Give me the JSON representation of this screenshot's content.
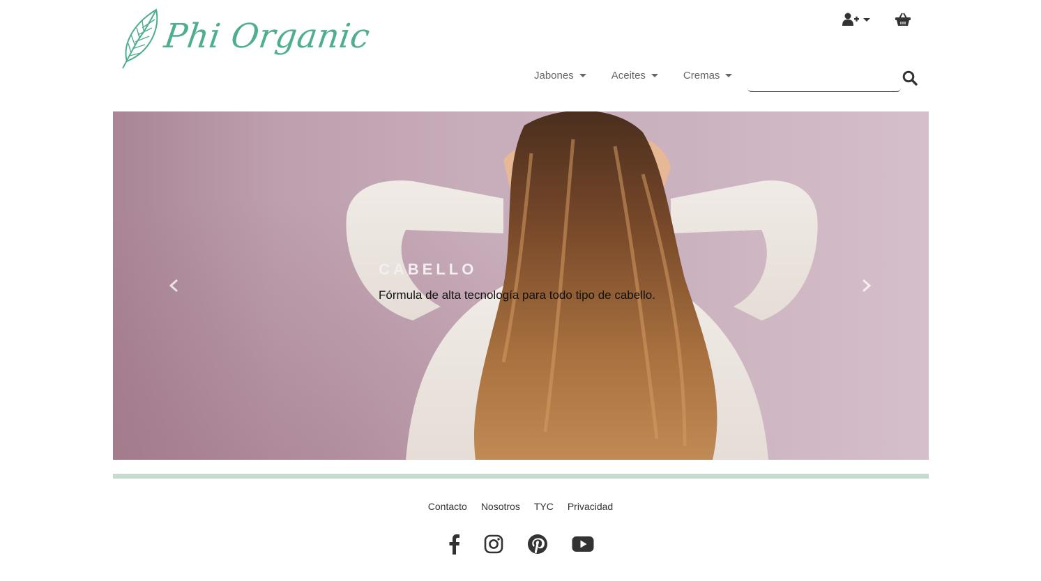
{
  "brand": {
    "name": "Phi Organic",
    "color": "#4fae8e"
  },
  "header": {
    "account_icon": "user-plus-icon",
    "cart_icon": "shopping-basket-icon"
  },
  "nav": {
    "items": [
      {
        "label": "Jabones"
      },
      {
        "label": "Aceites"
      },
      {
        "label": "Cremas"
      }
    ]
  },
  "search": {
    "value": "",
    "placeholder": "",
    "icon": "search-icon"
  },
  "carousel": {
    "slide": {
      "title": "CABELLO",
      "caption": "Fórmula de alta tecnología para todo tipo de cabello."
    },
    "prev_icon": "chevron-left-icon",
    "next_icon": "chevron-right-icon"
  },
  "footer": {
    "links": [
      {
        "label": "Contacto"
      },
      {
        "label": "Nosotros"
      },
      {
        "label": "TYC"
      },
      {
        "label": "Privacidad"
      }
    ],
    "social": [
      "facebook-icon",
      "instagram-icon",
      "pinterest-icon",
      "youtube-icon"
    ],
    "divider_color": "#c7dbd1"
  }
}
